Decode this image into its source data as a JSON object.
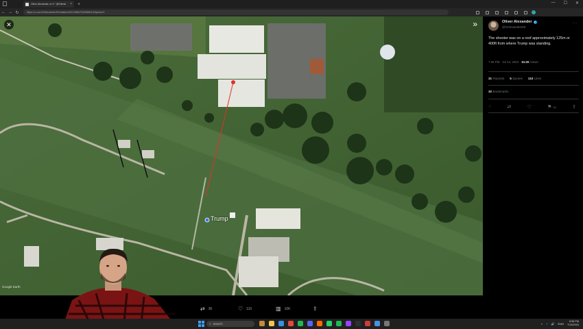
{
  "browser": {
    "tab_title": "Oliver Alexander on X: \"@Fabrizi",
    "tab_close": "×",
    "new_tab": "+",
    "url": "https://x.com/OAlexanderDK/status/1812288479438881134/photo/1",
    "window_controls": [
      "—",
      "☐",
      "✕"
    ]
  },
  "viewer": {
    "close_glyph": "✕",
    "next_glyph": "»",
    "map_label": "Trump",
    "map_credit": "Google Earth"
  },
  "action_bar": {
    "retweets": "36",
    "likes": "110",
    "views": "10K"
  },
  "tweet": {
    "author_name": "Oliver Alexander",
    "author_handle": "@OAlexanderDK",
    "text": "The shooter was on a roof approximately 125m or 400ft from where Trump was standing.",
    "time": "7:36 PM · Jul 13, 2024 · ",
    "views_count": "10.2K",
    "views_label": " Views",
    "reposts_count": "31",
    "reposts_label": "Reposts",
    "quotes_count": "5",
    "quotes_label": "Quotes",
    "likes_count": "110",
    "likes_label": "Likes",
    "bookmarks_count": "32",
    "bookmarks_label": "Bookmarks",
    "bookmark_inline": "32"
  },
  "taskbar": {
    "search_placeholder": "Search",
    "lang": "ENG",
    "time": "8:36 PM",
    "date": "7/13/2024"
  },
  "colors": {
    "x_blue": "#1d9bf0",
    "muted": "#71767b",
    "text": "#e7e9ea",
    "marker_red": "#e0322b"
  }
}
